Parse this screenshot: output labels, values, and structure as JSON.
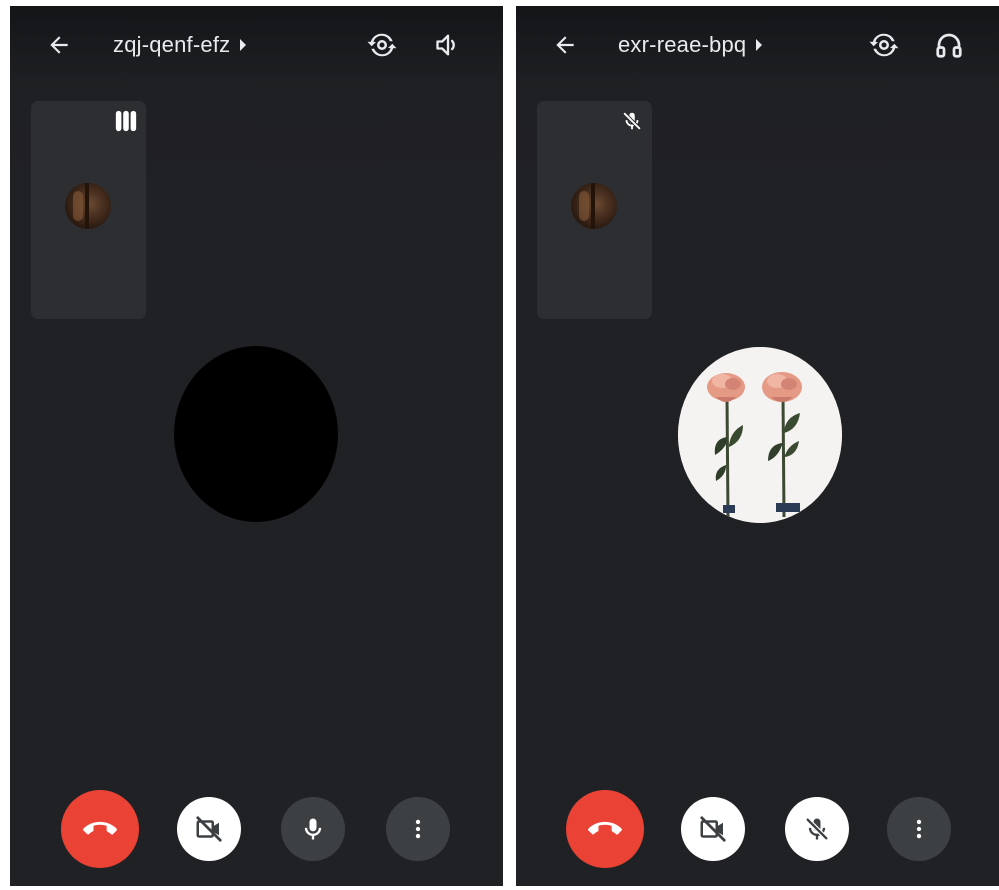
{
  "screens": [
    {
      "meeting_code": "zqj-qenf-efz",
      "top_right_icon": "speaker-icon",
      "self_tile_indicator": "audio-level-icon",
      "remote_video": "black",
      "mic_state": "on"
    },
    {
      "meeting_code": "exr-reae-bpq",
      "top_right_icon": "headphones-icon",
      "self_tile_indicator": "mic-off-icon",
      "remote_video": "roses-photo",
      "mic_state": "muted"
    }
  ],
  "colors": {
    "background": "#202124",
    "tile": "#2d2e31",
    "hangup": "#ea4335",
    "control_dark": "#3c4043",
    "control_light": "#ffffff",
    "text": "#e8eaed"
  }
}
